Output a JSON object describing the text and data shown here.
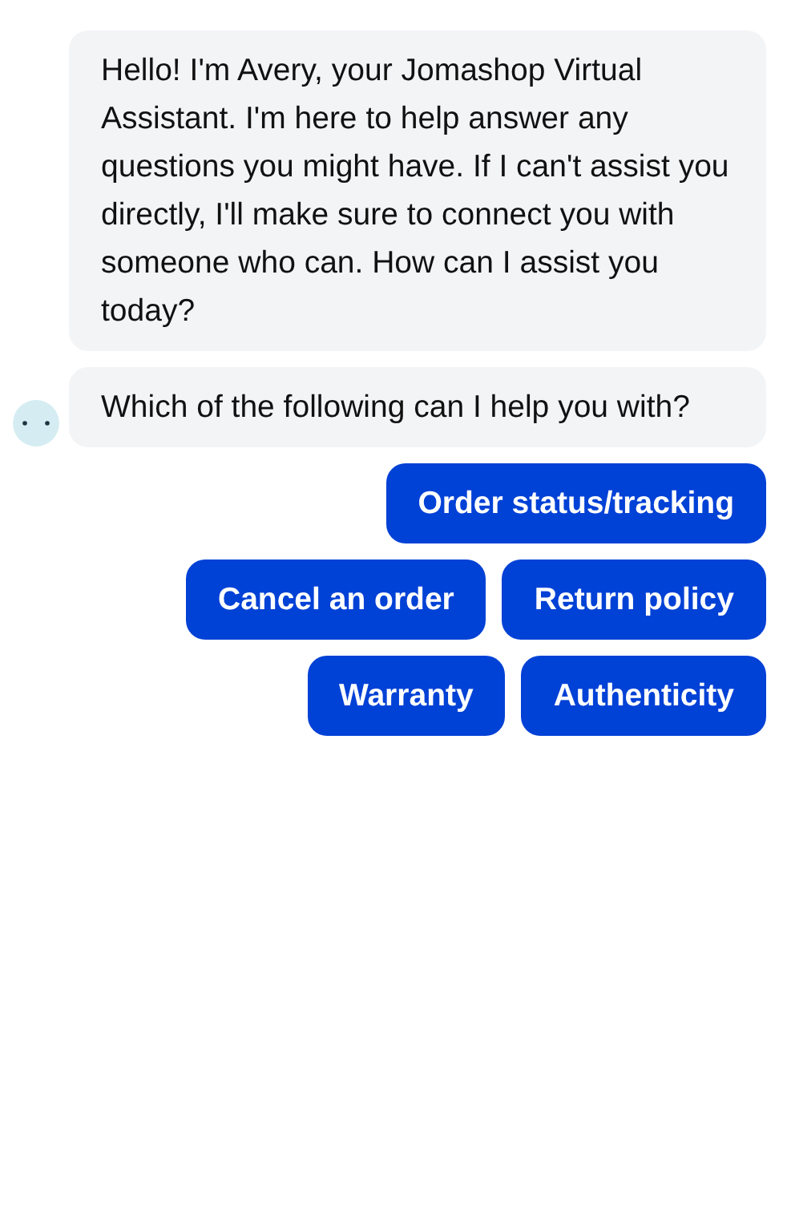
{
  "messages": [
    {
      "text": "Hello! I'm Avery, your Jomashop Virtual Assistant. I'm here to help answer any questions you might have. If I can't assist you directly, I'll make sure to connect you with someone who can. How can I assist you today?"
    },
    {
      "text": "Which of the following can I help you with?"
    }
  ],
  "quick_replies": [
    [
      "Order status/tracking"
    ],
    [
      "Cancel an order",
      "Return policy"
    ],
    [
      "Warranty",
      "Authenticity"
    ]
  ]
}
